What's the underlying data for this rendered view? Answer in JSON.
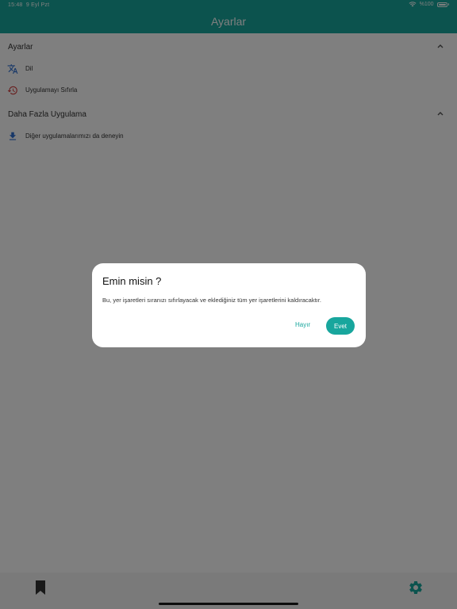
{
  "status_bar": {
    "time": "15:48",
    "date": "9 Eyl Pzt",
    "battery": "%100"
  },
  "header": {
    "title": "Ayarlar"
  },
  "sections": [
    {
      "title": "Ayarlar",
      "items": [
        {
          "label": "Dil",
          "icon": "translate-icon"
        },
        {
          "label": "Uygulamayı Sıfırla",
          "icon": "history-icon"
        }
      ]
    },
    {
      "title": "Daha Fazla Uygulama",
      "items": [
        {
          "label": "Diğer uygulamalarımızı da deneyin",
          "icon": "download-icon"
        }
      ]
    }
  ],
  "bottom_nav": {
    "items": [
      "bookmark-icon",
      "gear-icon"
    ]
  },
  "dialog": {
    "title": "Emin misin ?",
    "message": "Bu, yer işaretleri sıranızı sıfırlayacak ve eklediğiniz tüm yer işaretlerini kaldıracaktır.",
    "cancel_label": "Hayır",
    "confirm_label": "Evet"
  },
  "colors": {
    "accent": "#18a69d",
    "icon_blue": "#2f6fd1",
    "icon_red": "#d23b3b"
  }
}
